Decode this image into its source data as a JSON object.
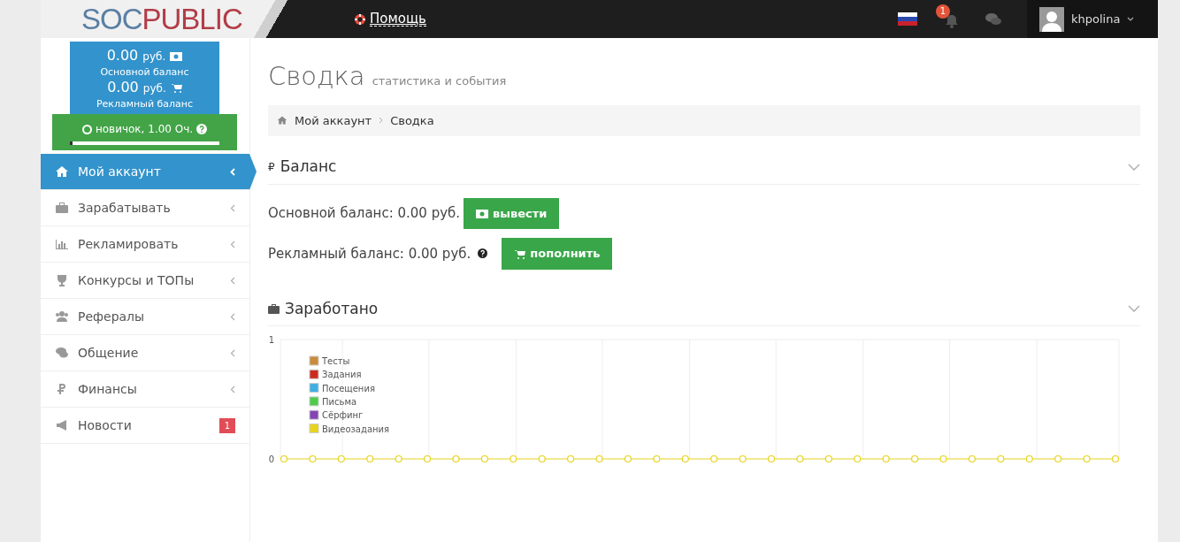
{
  "header": {
    "logo_left": "SOC",
    "logo_right": "PUBLIC",
    "help": "Помощь",
    "notifications_count": "1",
    "username": "khpolina"
  },
  "sidebar": {
    "balance": {
      "main_amount": "0.00",
      "main_currency": "руб.",
      "main_label": "Основной баланс",
      "ad_amount": "0.00",
      "ad_currency": "руб.",
      "ad_label": "Рекламный баланс"
    },
    "rank": {
      "text": "новичок, 1.00 Оч.",
      "level": 0.02
    },
    "items": [
      {
        "label": "Мой аккаунт",
        "selected": true,
        "expandable": true
      },
      {
        "label": "Зарабатывать",
        "selected": false,
        "expandable": true
      },
      {
        "label": "Рекламировать",
        "selected": false,
        "expandable": true
      },
      {
        "label": "Конкурсы и ТОПы",
        "selected": false,
        "expandable": true
      },
      {
        "label": "Рефералы",
        "selected": false,
        "expandable": true
      },
      {
        "label": "Общение",
        "selected": false,
        "expandable": true
      },
      {
        "label": "Финансы",
        "selected": false,
        "expandable": true
      },
      {
        "label": "Новости",
        "selected": false,
        "expandable": false,
        "badge": "1"
      }
    ]
  },
  "page": {
    "title": "Сводка",
    "subtitle": "статистика и события",
    "breadcrumb": [
      "Мой аккаунт",
      "Сводка"
    ]
  },
  "balance_section": {
    "currency_sign": "₽",
    "title": "Баланс",
    "main_text": "Основной баланс: 0.00 руб.",
    "withdraw_button": "вывести",
    "ad_text": "Рекламный баланс: 0.00 руб.",
    "topup_button": "пополнить"
  },
  "earned_section": {
    "title": "Заработано",
    "chart_data": {
      "type": "line",
      "yticks": [
        0,
        1
      ],
      "ylim": [
        0,
        1
      ],
      "grid": true,
      "legend": true,
      "series": [
        {
          "name": "Тесты",
          "color": "#cb8b3c",
          "values": [
            null,
            null,
            null,
            null,
            null,
            null,
            null,
            null,
            null,
            null,
            null,
            null,
            null,
            null,
            null,
            null,
            null,
            null,
            null,
            null,
            null,
            null,
            null,
            null,
            null,
            null,
            null,
            null,
            null,
            null
          ]
        },
        {
          "name": "Задания",
          "color": "#cc2a1e",
          "values": [
            null,
            null,
            null,
            null,
            null,
            null,
            null,
            null,
            null,
            null,
            null,
            null,
            null,
            null,
            null,
            null,
            null,
            null,
            null,
            null,
            null,
            null,
            null,
            null,
            null,
            null,
            null,
            null,
            null,
            null
          ]
        },
        {
          "name": "Посещения",
          "color": "#3eafe3",
          "values": [
            null,
            null,
            null,
            null,
            null,
            null,
            null,
            null,
            null,
            null,
            null,
            null,
            null,
            null,
            null,
            null,
            null,
            null,
            null,
            null,
            null,
            null,
            null,
            null,
            null,
            null,
            null,
            null,
            null,
            null
          ]
        },
        {
          "name": "Письма",
          "color": "#4ecb4a",
          "values": [
            null,
            null,
            null,
            null,
            null,
            null,
            null,
            null,
            null,
            null,
            null,
            null,
            null,
            null,
            null,
            null,
            null,
            null,
            null,
            null,
            null,
            null,
            null,
            null,
            null,
            null,
            null,
            null,
            null,
            null
          ]
        },
        {
          "name": "Сёрфинг",
          "color": "#8444b4",
          "values": [
            null,
            null,
            null,
            null,
            null,
            null,
            null,
            null,
            null,
            null,
            null,
            null,
            null,
            null,
            null,
            null,
            null,
            null,
            null,
            null,
            null,
            null,
            null,
            null,
            null,
            null,
            null,
            null,
            null,
            null
          ]
        },
        {
          "name": "Видеозадания",
          "color": "#e8d41a",
          "marker": "circle",
          "values": [
            0,
            0,
            0,
            0,
            0,
            0,
            0,
            0,
            0,
            0,
            0,
            0,
            0,
            0,
            0,
            0,
            0,
            0,
            0,
            0,
            0,
            0,
            0,
            0,
            0,
            0,
            0,
            0,
            0,
            0
          ]
        }
      ]
    }
  }
}
